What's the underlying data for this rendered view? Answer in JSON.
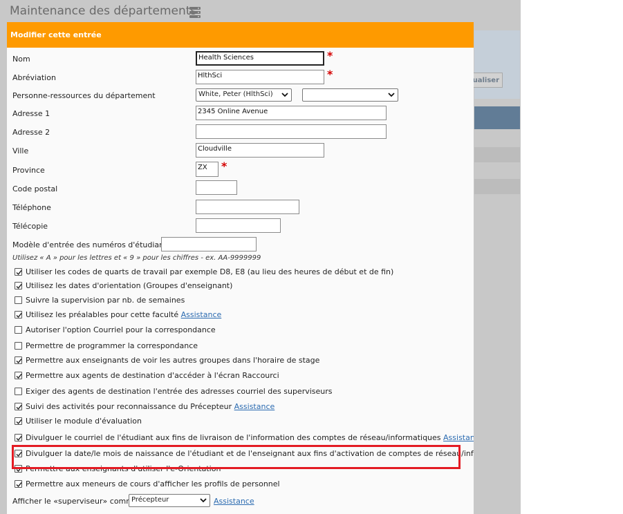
{
  "page": {
    "title": "Maintenance des départements",
    "title_icon": "server-stack-icon",
    "bg_button_label": "ualiser"
  },
  "modal": {
    "header": "Modifier cette entrée",
    "fields": {
      "nom": {
        "label": "Nom",
        "value": "Health Sciences"
      },
      "abreviation": {
        "label": "Abréviation",
        "value": "HlthSci"
      },
      "personne": {
        "label": "Personne-ressources du département",
        "selected": "White, Peter (HlthSci)",
        "selected2": ""
      },
      "adresse1": {
        "label": "Adresse 1",
        "value": "2345 Online Avenue"
      },
      "adresse2": {
        "label": "Adresse 2",
        "value": ""
      },
      "ville": {
        "label": "Ville",
        "value": "Cloudville"
      },
      "province": {
        "label": "Province",
        "value": "ZX"
      },
      "code_postal": {
        "label": "Code postal",
        "value": ""
      },
      "telephone": {
        "label": "Téléphone",
        "value": ""
      },
      "telecopie": {
        "label": "Télécopie",
        "value": ""
      },
      "modele": {
        "label": "Modèle d'entrée des numéros d'étudiants",
        "value": ""
      }
    },
    "hint": "Utilisez « A » pour les lettres et « 9 » pour les chiffres - ex. AA-9999999",
    "required_mark": "*",
    "checkboxes": [
      {
        "label": "Utiliser les codes de quarts de travail par exemple D8, E8 (au lieu des heures de début et de fin)",
        "checked": true,
        "link": ""
      },
      {
        "label": "Utilisez les dates d'orientation (Groupes d'enseignant)",
        "checked": true,
        "link": ""
      },
      {
        "label": "Suivre la supervision par nb. de semaines",
        "checked": false,
        "link": ""
      },
      {
        "label": "Utilisez les préalables pour cette faculté",
        "checked": true,
        "link": "Assistance"
      },
      {
        "label": "Autoriser l'option Courriel pour la correspondance",
        "checked": false,
        "link": ""
      },
      {
        "label": "Permettre de programmer la correspondance",
        "checked": false,
        "link": ""
      },
      {
        "label": "Permettre aux enseignants de voir les autres groupes dans l'horaire de stage",
        "checked": true,
        "link": ""
      },
      {
        "label": "Permettre aux agents de destination d'accéder à l'écran Raccourci",
        "checked": true,
        "link": ""
      },
      {
        "label": "Exiger des agents de destination l'entrée des adresses courriel des superviseurs",
        "checked": false,
        "link": ""
      },
      {
        "label": "Suivi des activités pour reconnaissance du Précepteur",
        "checked": true,
        "link": "Assistance"
      },
      {
        "label": "Utiliser le module d'évaluation",
        "checked": true,
        "link": ""
      },
      {
        "label": "Divulguer le courriel de l'étudiant aux fins de livraison de l'information des comptes de réseau/informatiques",
        "checked": true,
        "link": "Assistance"
      },
      {
        "label": "Divulguer la date/le mois de naissance de l'étudiant et de l'enseignant aux fins d'activation de comptes de réseau/informatiques",
        "checked": true,
        "link": ""
      },
      {
        "label": "Permettre aux enseignants d'utiliser l'e-Orientation",
        "checked": true,
        "link": ""
      },
      {
        "label": "Permettre aux meneurs de cours d'afficher les profils de personnel",
        "checked": true,
        "link": ""
      }
    ],
    "supervisor": {
      "label": "Afficher le «superviseur» comme",
      "selected": "Précepteur",
      "link": "Assistance"
    }
  },
  "colors": {
    "header": "#fe9a00",
    "highlight": "#e31b23",
    "link": "#2a6ab0"
  }
}
